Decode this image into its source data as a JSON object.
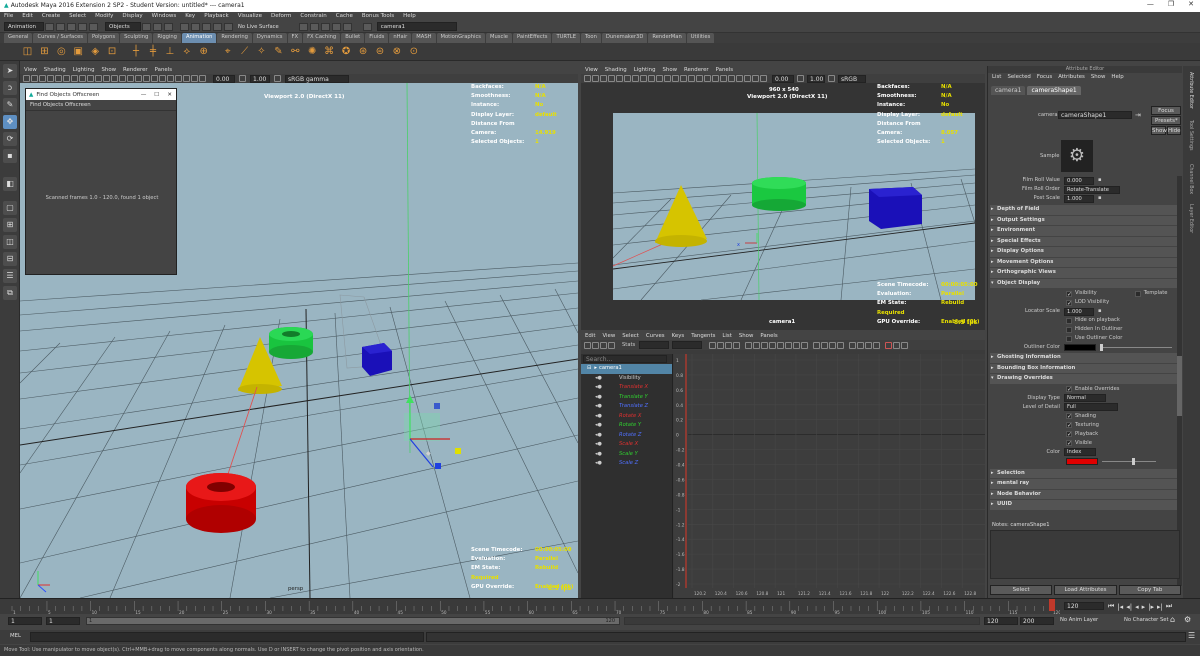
{
  "title": "Autodesk Maya 2016 Extension 2 SP2 - Student Version: untitled*   ---   camera1",
  "menus": [
    "File",
    "Edit",
    "Create",
    "Select",
    "Modify",
    "Display",
    "Windows",
    "Key",
    "Playback",
    "Visualize",
    "Deform",
    "Constrain",
    "Cache",
    "Bonus Tools",
    "Help"
  ],
  "statusline": {
    "mode": "Animation",
    "objects_label": "Objects",
    "no_live": "No Live Surface",
    "camera_field": "camera1"
  },
  "shelf_tabs": [
    "General",
    "Curves / Surfaces",
    "Polygons",
    "Sculpting",
    "Rigging",
    "Animation",
    "Rendering",
    "Dynamics",
    "FX",
    "FX Caching",
    "Bullet",
    "Fluids",
    "nHair",
    "MASH",
    "MotionGraphics",
    "Muscle",
    "PaintEffects",
    "TURTLE",
    "Toon",
    "Dunemaker3D",
    "RenderMan",
    "Utilities"
  ],
  "active_shelf": "Animation",
  "panel_menus": [
    "View",
    "Shading",
    "Lighting",
    "Show",
    "Renderer",
    "Panels"
  ],
  "left_view": {
    "zoom_a": "0.00",
    "zoom_b": "1.00",
    "color_mgmt": "sRGB gamma",
    "title": "Viewport 2.0 (DirectX 11)",
    "camera_name": "persp",
    "hud_top": [
      {
        "k": "Backfaces:",
        "v": "N/A"
      },
      {
        "k": "Smoothness:",
        "v": "N/A"
      },
      {
        "k": "Instance:",
        "v": "No"
      },
      {
        "k": "Display Layer:",
        "v": "default"
      },
      {
        "k": "Distance From Camera:",
        "v": "14.919"
      },
      {
        "k": "Selected Objects:",
        "v": "1"
      }
    ],
    "hud_bottom": [
      {
        "k": "Scene Timecode:",
        "v": "00:00:05:00"
      },
      {
        "k": "Evaluation:",
        "v": "Parallel"
      },
      {
        "k": "EM State:",
        "v": "Rebuild Required"
      },
      {
        "k": "GPU Override:",
        "v": "Enabled (0k)"
      }
    ],
    "fps": "8.5 fps"
  },
  "find_window": {
    "title": "Find Objects Offscreen",
    "subtitle": "Find Objects Offscreen",
    "message": "Scanned frames 1.0 - 120.0, found 1 object"
  },
  "right_view": {
    "zoom_a": "0.00",
    "zoom_b": "1.00",
    "color_mgmt": "sRGB gam",
    "resolution": "960 x 540",
    "title": "Viewport 2.0 (DirectX 11)",
    "camera_name": "camera1",
    "hud_top": [
      {
        "k": "Backfaces:",
        "v": "N/A"
      },
      {
        "k": "Smoothness:",
        "v": "N/A"
      },
      {
        "k": "Instance:",
        "v": "No"
      },
      {
        "k": "Display Layer:",
        "v": "default"
      },
      {
        "k": "Distance From Camera:",
        "v": "8.057"
      },
      {
        "k": "Selected Objects:",
        "v": "1"
      }
    ],
    "hud_bottom": [
      {
        "k": "Scene Timecode:",
        "v": "00:00:05:00"
      },
      {
        "k": "Evaluation:",
        "v": "Parallel"
      },
      {
        "k": "EM State:",
        "v": "Rebuild Required"
      },
      {
        "k": "GPU Override:",
        "v": "Enabled (0k)"
      }
    ],
    "fps": "8.5 fps"
  },
  "graph_editor": {
    "menus": [
      "Edit",
      "View",
      "Select",
      "Curves",
      "Keys",
      "Tangents",
      "List",
      "Show",
      "Panels"
    ],
    "stats": "Stats",
    "search_placeholder": "Search...",
    "root": "camera1",
    "channels": [
      {
        "name": "Visibility",
        "color": "#cccccc"
      },
      {
        "name": "Translate X",
        "color": "#e03030"
      },
      {
        "name": "Translate Y",
        "color": "#30d030"
      },
      {
        "name": "Translate Z",
        "color": "#5070ff"
      },
      {
        "name": "Rotate X",
        "color": "#e03030"
      },
      {
        "name": "Rotate Y",
        "color": "#30d030"
      },
      {
        "name": "Rotate Z",
        "color": "#5070ff"
      },
      {
        "name": "Scale X",
        "color": "#e03030"
      },
      {
        "name": "Scale Y",
        "color": "#30d030"
      },
      {
        "name": "Scale Z",
        "color": "#5070ff"
      }
    ],
    "y_labels": [
      "1",
      "0.8",
      "0.6",
      "0.4",
      "0.2",
      "0",
      "-0.2",
      "-0.4",
      "-0.6",
      "-0.8",
      "-1",
      "-1.2",
      "-1.4",
      "-1.6",
      "-1.8",
      "-2"
    ],
    "x_labels": [
      "120.2",
      "120.4",
      "120.6",
      "120.8",
      "121",
      "121.2",
      "121.4",
      "121.6",
      "121.8",
      "122",
      "122.2",
      "122.4",
      "122.6",
      "122.8"
    ]
  },
  "attr_editor": {
    "header": "Attribute Editor",
    "menus": [
      "List",
      "Selected",
      "Focus",
      "Attributes",
      "Show",
      "Help"
    ],
    "tabs": [
      "camera1",
      "cameraShape1"
    ],
    "camera_label": "camera",
    "camera_value": "cameraShape1",
    "focus_btn": "Focus",
    "presets_btn": "Presets*",
    "show_btn": "Show",
    "hide_btn": "Hide",
    "sample_label": "Sample",
    "film_roll_value_label": "Film Roll Value",
    "film_roll_value": "0.000",
    "film_roll_order_label": "Film Roll Order",
    "film_roll_order": "Rotate-Translate",
    "post_scale_label": "Post Scale",
    "post_scale": "1.000",
    "sections_a": [
      "Depth of Field",
      "Output Settings",
      "Environment",
      "Special Effects",
      "Display Options",
      "Movement Options",
      "Orthographic Views"
    ],
    "object_display": "Object Display",
    "visibility": "Visibility",
    "template": "Template",
    "lod_visibility": "LOD Visibility",
    "locator_scale_label": "Locator Scale",
    "locator_scale": "1.000",
    "hide_on_playback": "Hide on playback",
    "hidden_in_outliner": "Hidden In Outliner",
    "use_outliner_color": "Use Outliner Color",
    "outliner_color": "Outliner Color",
    "ghosting": "Ghosting Information",
    "bounding_box": "Bounding Box Information",
    "drawing_overrides": "Drawing Overrides",
    "enable_overrides": "Enable Overrides",
    "display_type_label": "Display Type",
    "display_type": "Normal",
    "lod_label": "Level of Detail",
    "lod": "Full",
    "shading": "Shading",
    "texturing": "Texturing",
    "playback": "Playback",
    "visible": "Visible",
    "color_label": "Color",
    "color_mode": "Index",
    "override_color": "#e00000",
    "sections_b": [
      "Selection",
      "mental ray",
      "Node Behavior",
      "UUID"
    ],
    "notes": "Notes:  cameraShape1",
    "select_btn": "Select",
    "load_attrs_btn": "Load Attributes",
    "copy_tab_btn": "Copy Tab"
  },
  "right_strip_tabs": [
    "Attribute Editor",
    "Tool Settings",
    "Channel Box",
    "Layer Editor"
  ],
  "timeline": {
    "ticks": [
      "1",
      "5",
      "10",
      "15",
      "20",
      "25",
      "30",
      "35",
      "40",
      "45",
      "50",
      "55",
      "60",
      "65",
      "70",
      "75",
      "80",
      "85",
      "90",
      "95",
      "100",
      "105",
      "110",
      "115",
      "120"
    ],
    "current_frame": "120",
    "frame_field": "120"
  },
  "range": {
    "start": "1",
    "start2": "1",
    "slider_start": "1",
    "slider_end": "120",
    "end": "120",
    "end2": "200",
    "anim_layer": "No Anim Layer",
    "char_set": "No Character Set"
  },
  "mel_label": "MEL",
  "help_text": "Move Tool: Use manipulator to move object(s). Ctrl+MMB+drag to move components along normals. Use D or INSERT to change the pivot position and axis orientation."
}
